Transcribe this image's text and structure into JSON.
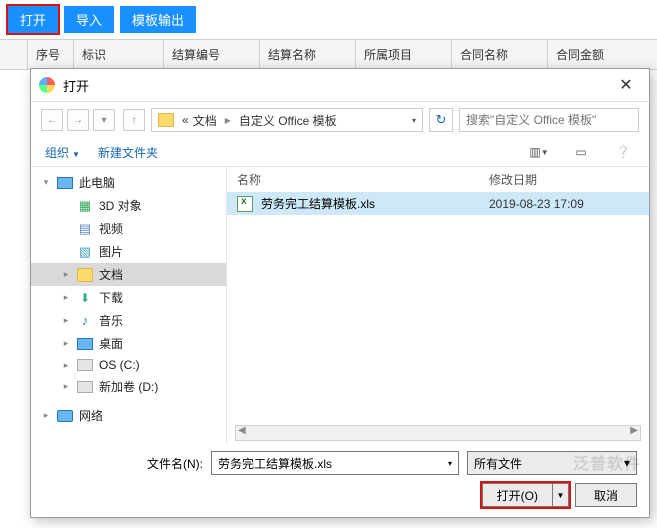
{
  "toolbar": {
    "open": "打开",
    "import": "导入",
    "template_out": "模板输出"
  },
  "grid": {
    "cols": [
      "",
      "序号",
      "标识",
      "结算编号",
      "结算名称",
      "所属项目",
      "合同名称",
      "合同金额"
    ]
  },
  "dialog": {
    "title": "打开",
    "path": {
      "seg1": "文档",
      "seg2": "自定义 Office 模板"
    },
    "search_placeholder": "搜索\"自定义 Office 模板\"",
    "organize": "组织",
    "new_folder": "新建文件夹",
    "cols": {
      "name": "名称",
      "date": "修改日期"
    },
    "tree": [
      {
        "label": "此电脑",
        "icon": "pc",
        "lv": 1,
        "exp": "▾"
      },
      {
        "label": "3D 对象",
        "icon": "cube",
        "lv": 2,
        "exp": ""
      },
      {
        "label": "视频",
        "icon": "film",
        "lv": 2,
        "exp": ""
      },
      {
        "label": "图片",
        "icon": "pic",
        "lv": 2,
        "exp": ""
      },
      {
        "label": "文档",
        "icon": "folder",
        "lv": 2,
        "exp": "▸",
        "selected": true
      },
      {
        "label": "下载",
        "icon": "dl",
        "lv": 2,
        "exp": "▸"
      },
      {
        "label": "音乐",
        "icon": "music",
        "lv": 2,
        "exp": "▸"
      },
      {
        "label": "桌面",
        "icon": "pc",
        "lv": 2,
        "exp": "▸"
      },
      {
        "label": "OS (C:)",
        "icon": "drive",
        "lv": 2,
        "exp": "▸"
      },
      {
        "label": "新加卷 (D:)",
        "icon": "drive",
        "lv": 2,
        "exp": "▸"
      },
      {
        "label": "",
        "icon": "",
        "lv": 0,
        "spacer": true
      },
      {
        "label": "网络",
        "icon": "net",
        "lv": 1,
        "exp": "▸"
      }
    ],
    "files": [
      {
        "name": "劳务完工结算模板.xls",
        "date": "2019-08-23 17:09",
        "selected": true
      }
    ],
    "filename_label": "文件名(N):",
    "filename_value": "劳务完工结算模板.xls",
    "filter": "所有文件",
    "open_btn": "打开(O)",
    "cancel_btn": "取消"
  },
  "watermark": "泛普软件"
}
